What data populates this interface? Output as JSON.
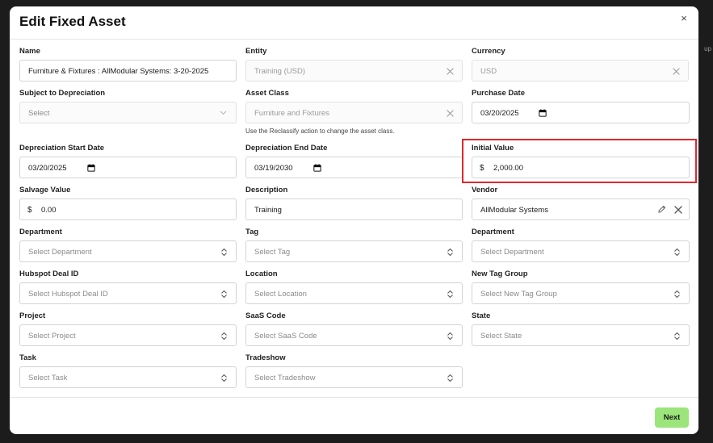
{
  "modal": {
    "title": "Edit Fixed Asset",
    "close_label": "×"
  },
  "fields": {
    "name": {
      "label": "Name",
      "value": "Furniture & Fixtures : AllModular Systems:  3-20-2025"
    },
    "entity": {
      "label": "Entity",
      "value": "Training (USD)"
    },
    "currency": {
      "label": "Currency",
      "value": "USD"
    },
    "subject_to_depreciation": {
      "label": "Subject to Depreciation",
      "placeholder": "Select"
    },
    "asset_class": {
      "label": "Asset Class",
      "value": "Furniture and Fixtures",
      "hint": "Use the Reclassify action to change the asset class."
    },
    "purchase_date": {
      "label": "Purchase Date",
      "value": "03/20/2025"
    },
    "depreciation_start_date": {
      "label": "Depreciation Start Date",
      "value": "03/20/2025"
    },
    "depreciation_end_date": {
      "label": "Depreciation End Date",
      "value": "03/19/2030"
    },
    "initial_value": {
      "label": "Initial Value",
      "currency_symbol": "$",
      "value": "2,000.00"
    },
    "salvage_value": {
      "label": "Salvage Value",
      "currency_symbol": "$",
      "value": "0.00"
    },
    "description": {
      "label": "Description",
      "value": "Training"
    },
    "vendor": {
      "label": "Vendor",
      "value": "AllModular Systems"
    },
    "department_1": {
      "label": "Department",
      "placeholder": "Select Department"
    },
    "tag": {
      "label": "Tag",
      "placeholder": "Select Tag"
    },
    "department_2": {
      "label": "Department",
      "placeholder": "Select Department"
    },
    "hubspot_deal_id": {
      "label": "Hubspot Deal ID",
      "placeholder": "Select Hubspot Deal ID"
    },
    "location": {
      "label": "Location",
      "placeholder": "Select Location"
    },
    "new_tag_group": {
      "label": "New Tag Group",
      "placeholder": "Select New Tag Group"
    },
    "project": {
      "label": "Project",
      "placeholder": "Select Project"
    },
    "saas_code": {
      "label": "SaaS Code",
      "placeholder": "Select SaaS Code"
    },
    "state": {
      "label": "State",
      "placeholder": "Select State"
    },
    "task": {
      "label": "Task",
      "placeholder": "Select Task"
    },
    "tradeshow": {
      "label": "Tradeshow",
      "placeholder": "Select Tradeshow"
    }
  },
  "footer": {
    "next_label": "Next"
  },
  "background": {
    "hint_text": "up"
  },
  "colors": {
    "highlight": "#e3262c",
    "primary_button": "#9be57a"
  }
}
